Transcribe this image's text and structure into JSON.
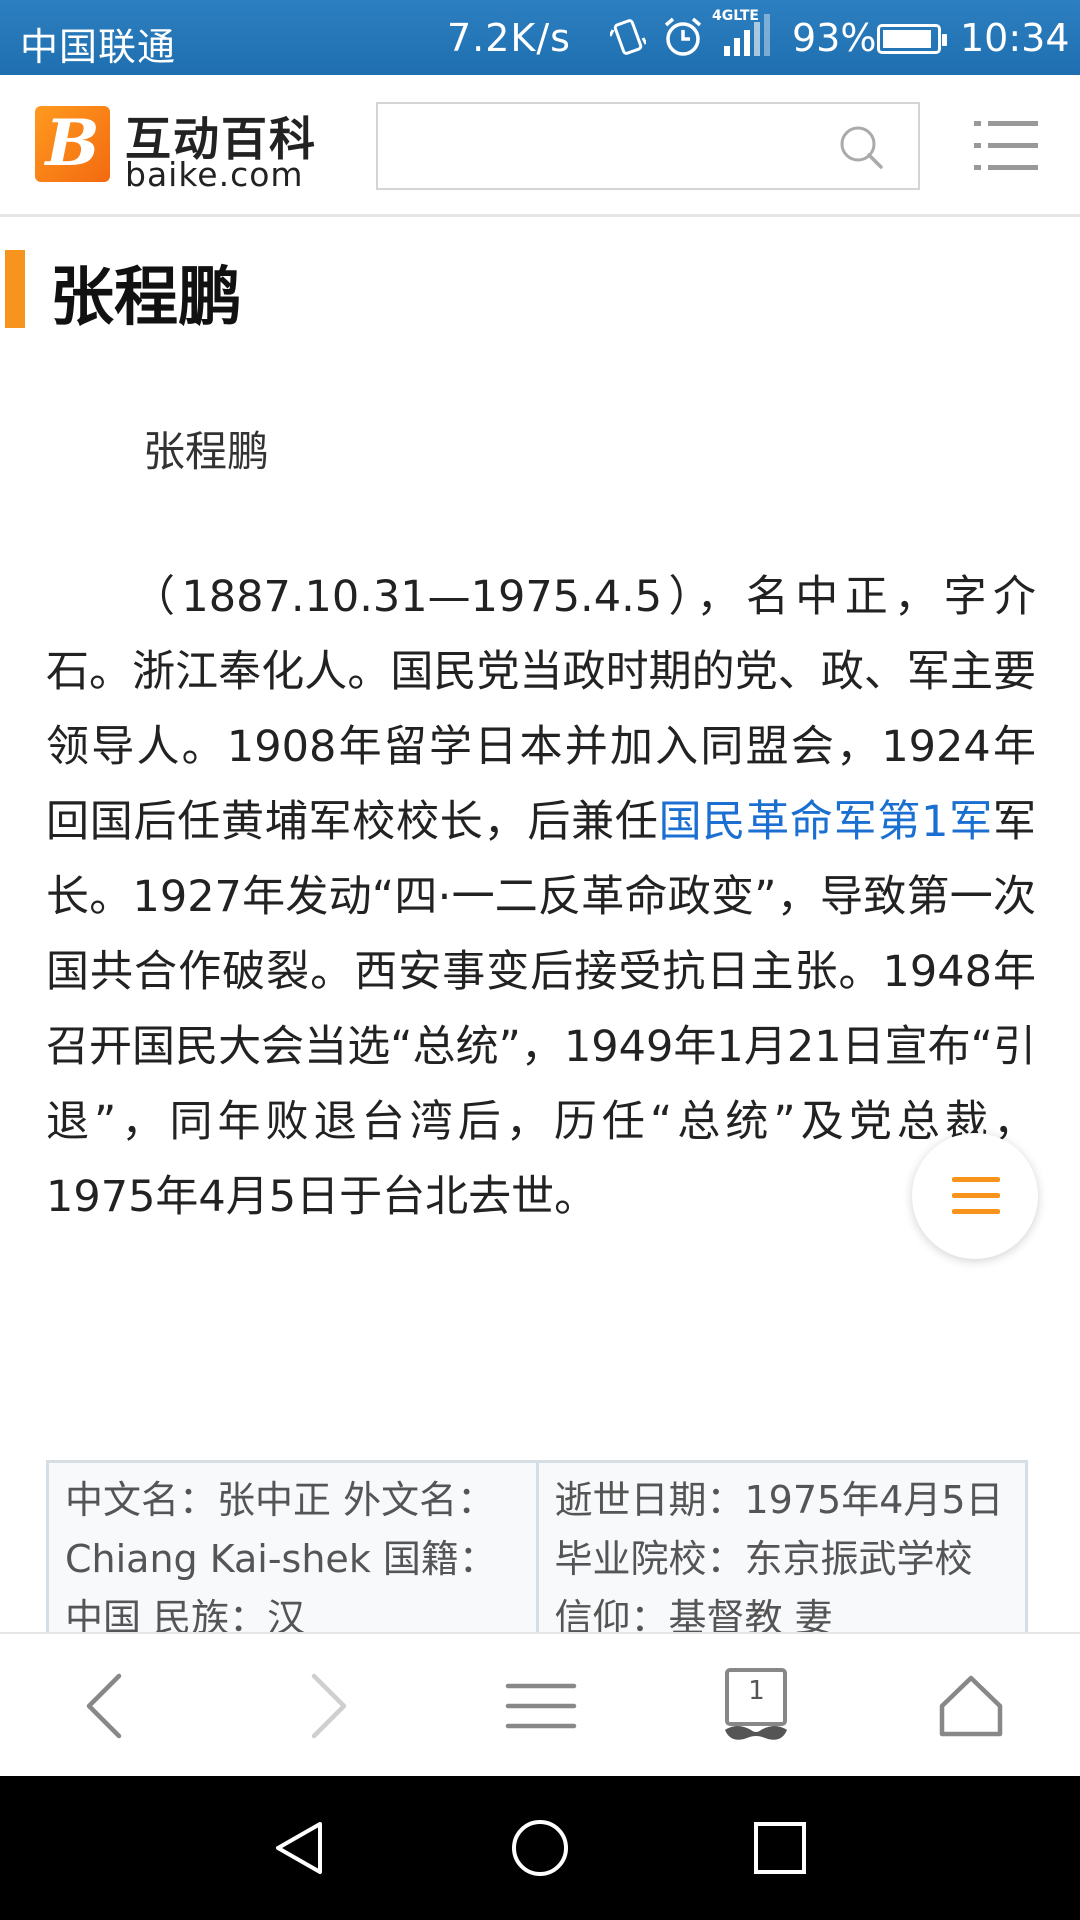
{
  "status_bar": {
    "carrier": "中国联通",
    "speed": "7.2K/s",
    "network_type": "4GLTE",
    "battery_percent": "93%",
    "battery_level": 0.93,
    "time": "10:34"
  },
  "header": {
    "logo_cn": "互动百科",
    "logo_en": "baike.com",
    "logo_mark": "B",
    "search_placeholder": "",
    "icons": [
      "search-icon",
      "menu-icon"
    ]
  },
  "page": {
    "title": "张程鹏",
    "image_caption": "张程鹏",
    "article": {
      "text_before_link": "（1887.10.31—1975.4.5），名中正，字介石。浙江奉化人。国民党当政时期的党、政、军主要领导人。1908年留学日本并加入同盟会，1924年回国后任黄埔军校校长，后兼任",
      "link_text": "国民革命军第1军",
      "text_after_link": "军长。1927年发动“四·一二反革命政变”，导致第一次国共合作破裂。西安事变后接受抗日主张。1948年召开国民大会当选“总统”，1949年1月21日宣布“引退”，同年败退台湾后，历任“总统”及党总裁，1975年4月5日于台北去世。"
    },
    "info_table": {
      "left_cell": "中文名：张中正 外文名：Chiang Kai-shek 国籍：中国 民族：汉",
      "right_cell": "逝世日期：1975年4月5日 毕业院校：东京振武学校 信仰：基督教 妻"
    }
  },
  "colors": {
    "status_bar": "#1f6fb0",
    "accent": "#f7941d",
    "link": "#1a6fd1"
  },
  "browser_bar": {
    "tab_count": "1",
    "icons": [
      "back-icon",
      "forward-icon",
      "menu-icon",
      "tabs-icon",
      "home-icon"
    ]
  },
  "nav_bar": {
    "icons": [
      "nav-back-icon",
      "nav-home-icon",
      "nav-recents-icon"
    ]
  }
}
